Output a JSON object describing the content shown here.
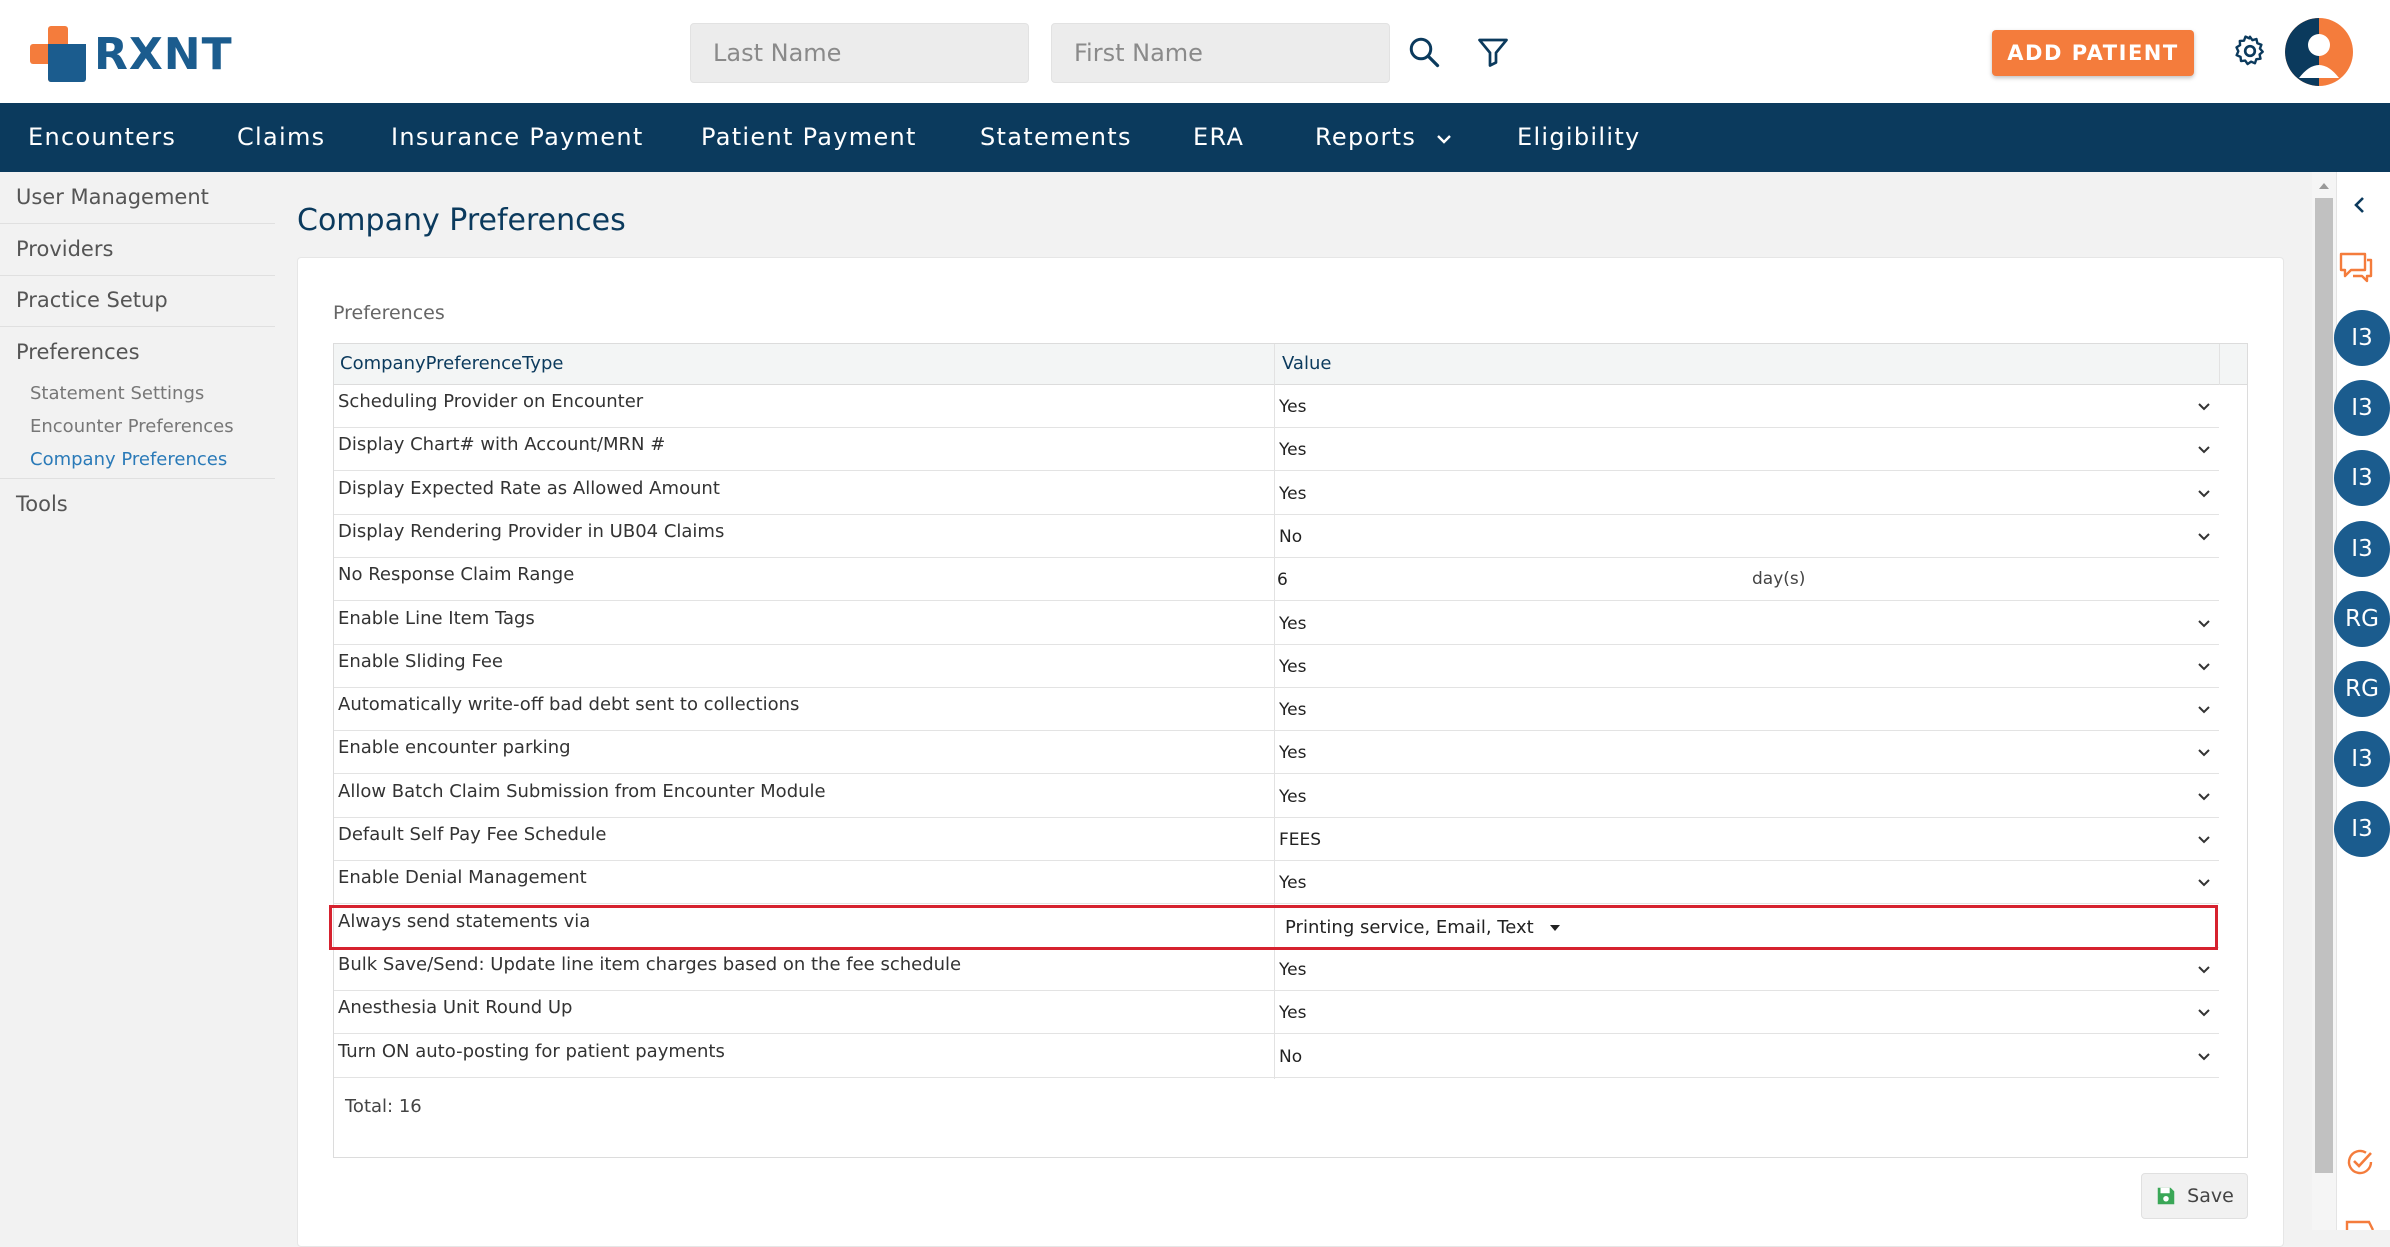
{
  "header": {
    "logo_text": "RXNT",
    "last_name_placeholder": "Last Name",
    "first_name_placeholder": "First Name",
    "add_patient_label": "ADD PATIENT"
  },
  "nav": {
    "items": [
      "Encounters",
      "Claims",
      "Insurance Payment",
      "Patient Payment",
      "Statements",
      "ERA",
      "Reports",
      "Eligibility"
    ]
  },
  "sidebar": {
    "items": [
      "User Management",
      "Providers",
      "Practice Setup",
      "Preferences",
      "Tools"
    ],
    "sub_items": [
      "Statement Settings",
      "Encounter Preferences",
      "Company Preferences"
    ],
    "active_sub_item": "Company Preferences"
  },
  "main": {
    "page_title": "Company Preferences",
    "section_label": "Preferences",
    "columns": [
      "CompanyPreferenceType",
      "Value"
    ],
    "rows": [
      {
        "type": "Scheduling Provider on Encounter",
        "value": "Yes"
      },
      {
        "type": "Display Chart# with Account/MRN #",
        "value": "Yes"
      },
      {
        "type": "Display Expected Rate as Allowed Amount",
        "value": "Yes"
      },
      {
        "type": "Display Rendering Provider in UB04 Claims",
        "value": "No"
      },
      {
        "type": "No Response Claim Range",
        "value": "6",
        "unit": "day(s)"
      },
      {
        "type": "Enable Line Item Tags",
        "value": "Yes"
      },
      {
        "type": "Enable Sliding Fee",
        "value": "Yes"
      },
      {
        "type": "Automatically write-off bad debt sent to collections",
        "value": "Yes"
      },
      {
        "type": "Enable encounter parking",
        "value": "Yes"
      },
      {
        "type": "Allow Batch Claim Submission from Encounter Module",
        "value": "Yes"
      },
      {
        "type": "Default Self Pay Fee Schedule",
        "value": "FEES"
      },
      {
        "type": "Enable Denial Management",
        "value": "Yes"
      },
      {
        "type": "Always send statements via",
        "value": "Printing service,  Email,  Text"
      },
      {
        "type": "Bulk Save/Send: Update line item charges based on the fee schedule",
        "value": "Yes"
      },
      {
        "type": "Anesthesia Unit Round Up",
        "value": "Yes"
      },
      {
        "type": "Turn ON auto-posting for patient payments",
        "value": "No"
      }
    ],
    "total_label": "Total: 16",
    "save_label": "Save"
  },
  "right_panel": {
    "badges": [
      "I3",
      "I3",
      "I3",
      "I3",
      "RG",
      "RG",
      "I3",
      "I3"
    ]
  },
  "colors": {
    "nav_bg": "#0b3a5d",
    "accent_orange": "#f47c3c",
    "brand_blue": "#1b5c8e",
    "highlight_red": "#d6222f"
  }
}
